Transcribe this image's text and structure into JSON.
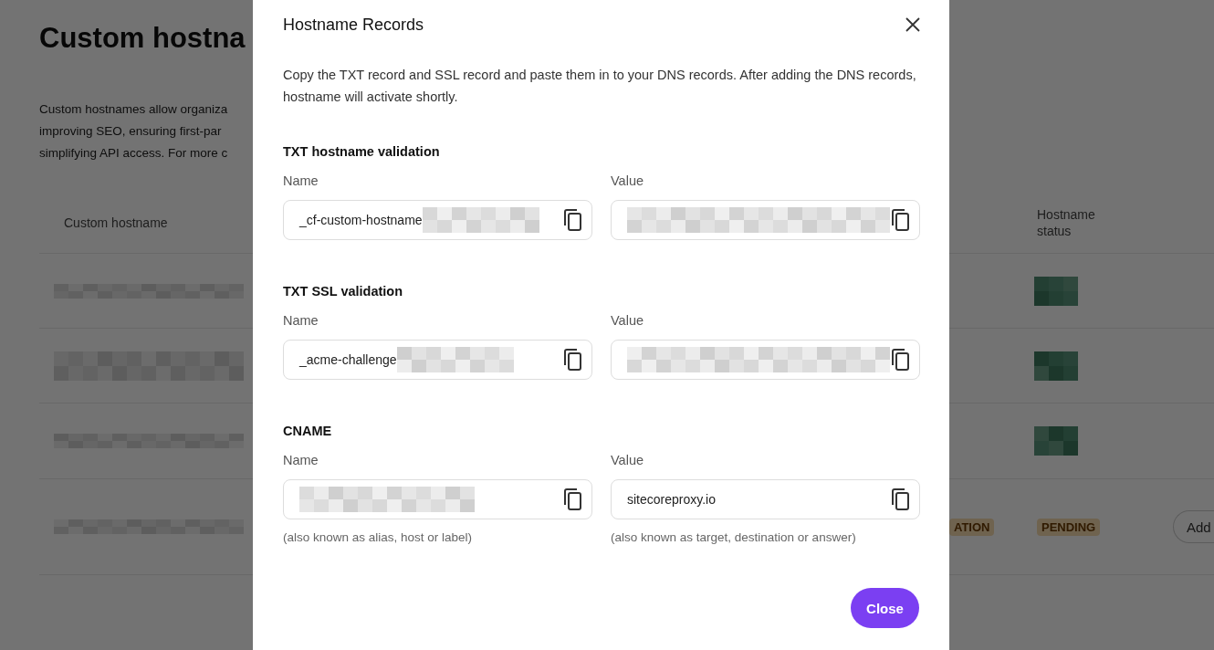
{
  "page": {
    "title": "Custom hostna",
    "description_lines": [
      "Custom hostnames allow organiza",
      "improving SEO, ensuring first-par",
      "simplifying API access. For more c"
    ],
    "table": {
      "columns": [
        "Custom hostname",
        "Hostname status"
      ],
      "rows": [
        {
          "hostname_redacted": true,
          "status_redacted": true
        },
        {
          "hostname_redacted": true,
          "status_redacted": true
        },
        {
          "hostname_redacted": true,
          "status_redacted": true
        },
        {
          "hostname_redacted": true,
          "column_3": "ATION",
          "status": "PENDING",
          "action": "Add"
        }
      ]
    }
  },
  "dialog": {
    "title": "Hostname Records",
    "description": "Copy the TXT record and SSL record and paste them in to your DNS records. After adding the DNS records, hostname will activate shortly.",
    "sections": [
      {
        "heading": "TXT hostname validation",
        "fields": [
          {
            "label": "Name",
            "value": "_cf-custom-hostname",
            "redacted": true
          },
          {
            "label": "Value",
            "redacted": true
          }
        ]
      },
      {
        "heading": "TXT SSL validation",
        "fields": [
          {
            "label": "Name",
            "value": "_acme-challenge",
            "redacted": true
          },
          {
            "label": "Value",
            "redacted": true
          }
        ]
      },
      {
        "heading": "CNAME",
        "fields": [
          {
            "label": "Name",
            "redacted": true,
            "hint": "(also known as alias, host or label)"
          },
          {
            "label": "Value",
            "value": "sitecoreproxy.io",
            "redacted": false,
            "hint": "(also known as target, destination or answer)"
          }
        ]
      }
    ],
    "close_button": "Close"
  }
}
